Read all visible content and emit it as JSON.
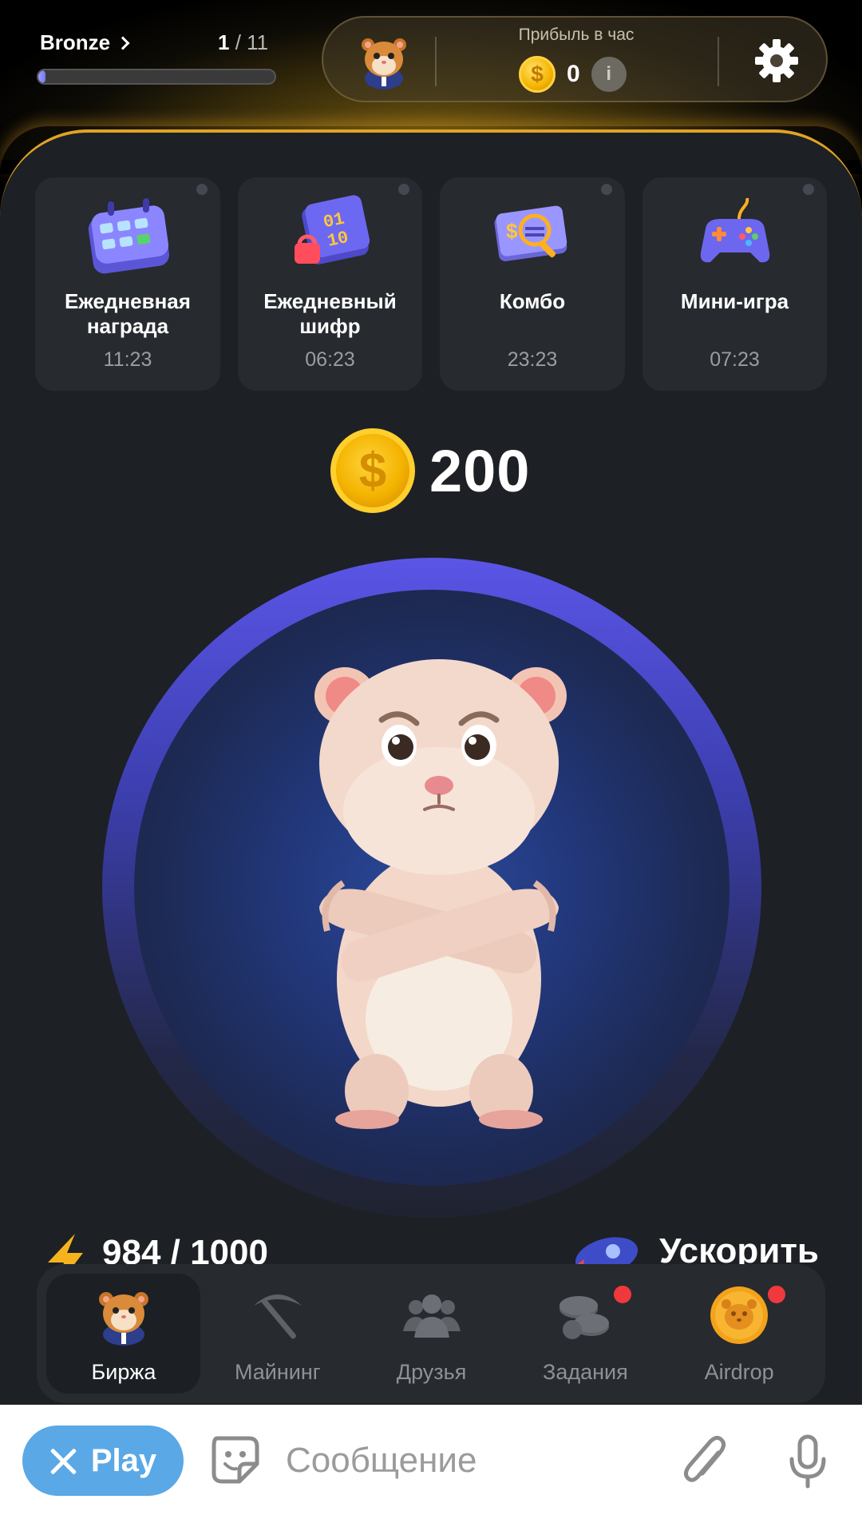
{
  "header": {
    "rank": "Bronze",
    "level_current": "1",
    "level_total": "11",
    "level_sep": " / ",
    "level_progress": 0.03,
    "profit_label": "Прибыль в час",
    "profit_value": "0"
  },
  "cards": [
    {
      "title": "Ежедневная награда",
      "time": "11:23",
      "icon": "calendar-icon"
    },
    {
      "title": "Ежедневный шифр",
      "time": "06:23",
      "icon": "cipher-icon"
    },
    {
      "title": "Комбо",
      "time": "23:23",
      "icon": "combo-icon"
    },
    {
      "title": "Мини-игра",
      "time": "07:23",
      "icon": "gamepad-icon"
    }
  ],
  "balance": "200",
  "energy": "984 / 1000",
  "boost_label": "Ускорить",
  "nav": [
    {
      "label": "Биржа",
      "icon": "hamster-icon",
      "active": true
    },
    {
      "label": "Майнинг",
      "icon": "pickaxe-icon"
    },
    {
      "label": "Друзья",
      "icon": "friends-icon"
    },
    {
      "label": "Задания",
      "icon": "coins-icon",
      "badge": true
    },
    {
      "label": "Airdrop",
      "icon": "airdrop-coin-icon",
      "badge": true
    }
  ],
  "chat": {
    "play_label": "Play",
    "placeholder": "Сообщение"
  },
  "colors": {
    "accent_gold": "#e0a326",
    "panel_bg": "#1d2025",
    "card_bg": "#272a2f",
    "tap_ring": "#5a55e6",
    "badge_red": "#f0393d",
    "play_blue": "#5aa8e6"
  }
}
